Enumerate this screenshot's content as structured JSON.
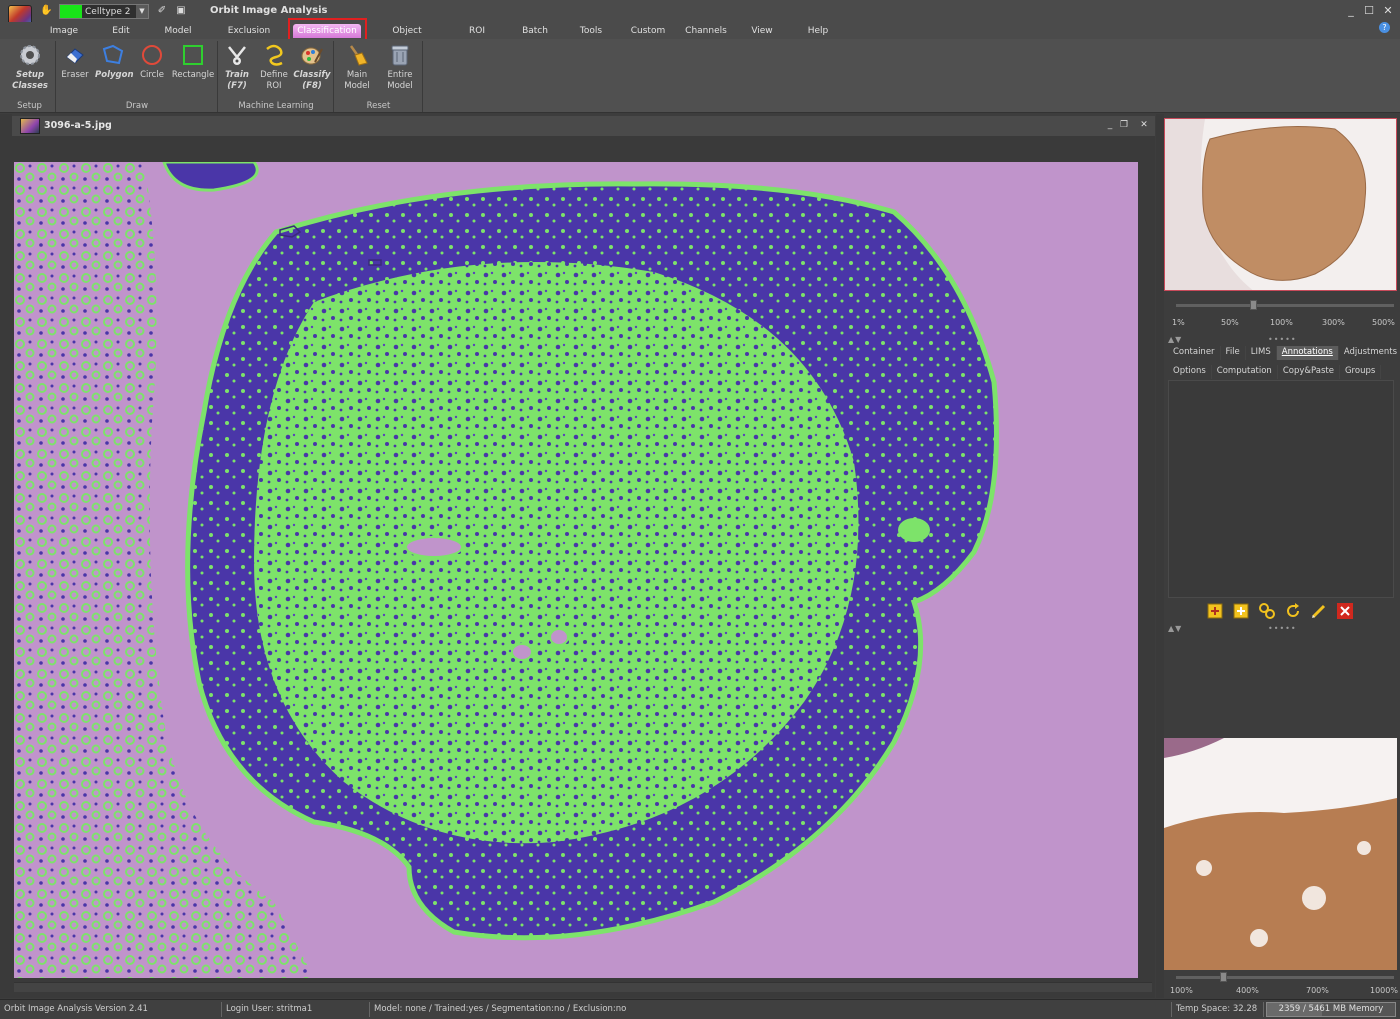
{
  "window": {
    "title": "Orbit Image Analysis",
    "class_selector": {
      "value": "Celltype 2",
      "color": "#18e418"
    }
  },
  "menu": {
    "tabs": [
      "Image",
      "Edit",
      "Model",
      "Exclusion Model",
      "Classification",
      "Object Detection",
      "ROI",
      "Batch",
      "Tools",
      "Custom",
      "Channels",
      "View",
      "Help"
    ],
    "active": "Classification",
    "active_color": "#e9a0e8"
  },
  "ribbon": {
    "groups": [
      {
        "label": "Setup",
        "buttons": [
          {
            "label": "Setup\nClasses",
            "icon": "gear-icon"
          }
        ]
      },
      {
        "label": "Draw",
        "buttons": [
          {
            "label": "Eraser",
            "icon": "eraser-icon"
          },
          {
            "label": "Polygon",
            "icon": "polygon-icon"
          },
          {
            "label": "Circle",
            "icon": "circle-icon"
          },
          {
            "label": "Rectangle",
            "icon": "rectangle-icon"
          }
        ]
      },
      {
        "label": "Machine Learning",
        "buttons": [
          {
            "label": "Train\n(F7)",
            "icon": "train-icon"
          },
          {
            "label": "Define\nROI",
            "icon": "define-roi-icon"
          },
          {
            "label": "Classify\n(F8)",
            "icon": "classify-icon"
          }
        ]
      },
      {
        "label": "Reset",
        "buttons": [
          {
            "label": "Main\nModel",
            "icon": "broom-icon"
          },
          {
            "label": "Entire\nModel",
            "icon": "trash-icon"
          }
        ]
      }
    ]
  },
  "document": {
    "filename": "3096-a-5.jpg",
    "colors": {
      "background": "#c094cb",
      "tissue": "#4a36a8",
      "classified": "#7de36a"
    }
  },
  "right_panel": {
    "zoom_labels": [
      "1%",
      "50%",
      "100%",
      "300%",
      "500%"
    ],
    "zoom_value_percent": 100,
    "tabs": [
      "Container",
      "File",
      "LIMS",
      "Annotations",
      "Adjustments"
    ],
    "active_tab": "Annotations",
    "sub_tabs": [
      "Options",
      "Computation",
      "Copy&Paste",
      "Groups"
    ],
    "annotation_tools": [
      "import-icon",
      "add-annotation-icon",
      "link-icon",
      "refresh-icon",
      "edit-icon",
      "delete-icon"
    ],
    "detail_zoom_labels": [
      "100%",
      "400%",
      "700%",
      "1000%"
    ]
  },
  "status": {
    "version": "Orbit Image Analysis Version 2.41",
    "login": "Login User: stritma1",
    "model": "Model: none / Trained:yes / Segmentation:no / Exclusion:no",
    "temp_space": "Temp Space: 32.28 GB",
    "memory": "2359 / 5461 MB Memory",
    "memory_fraction": 0.432
  }
}
